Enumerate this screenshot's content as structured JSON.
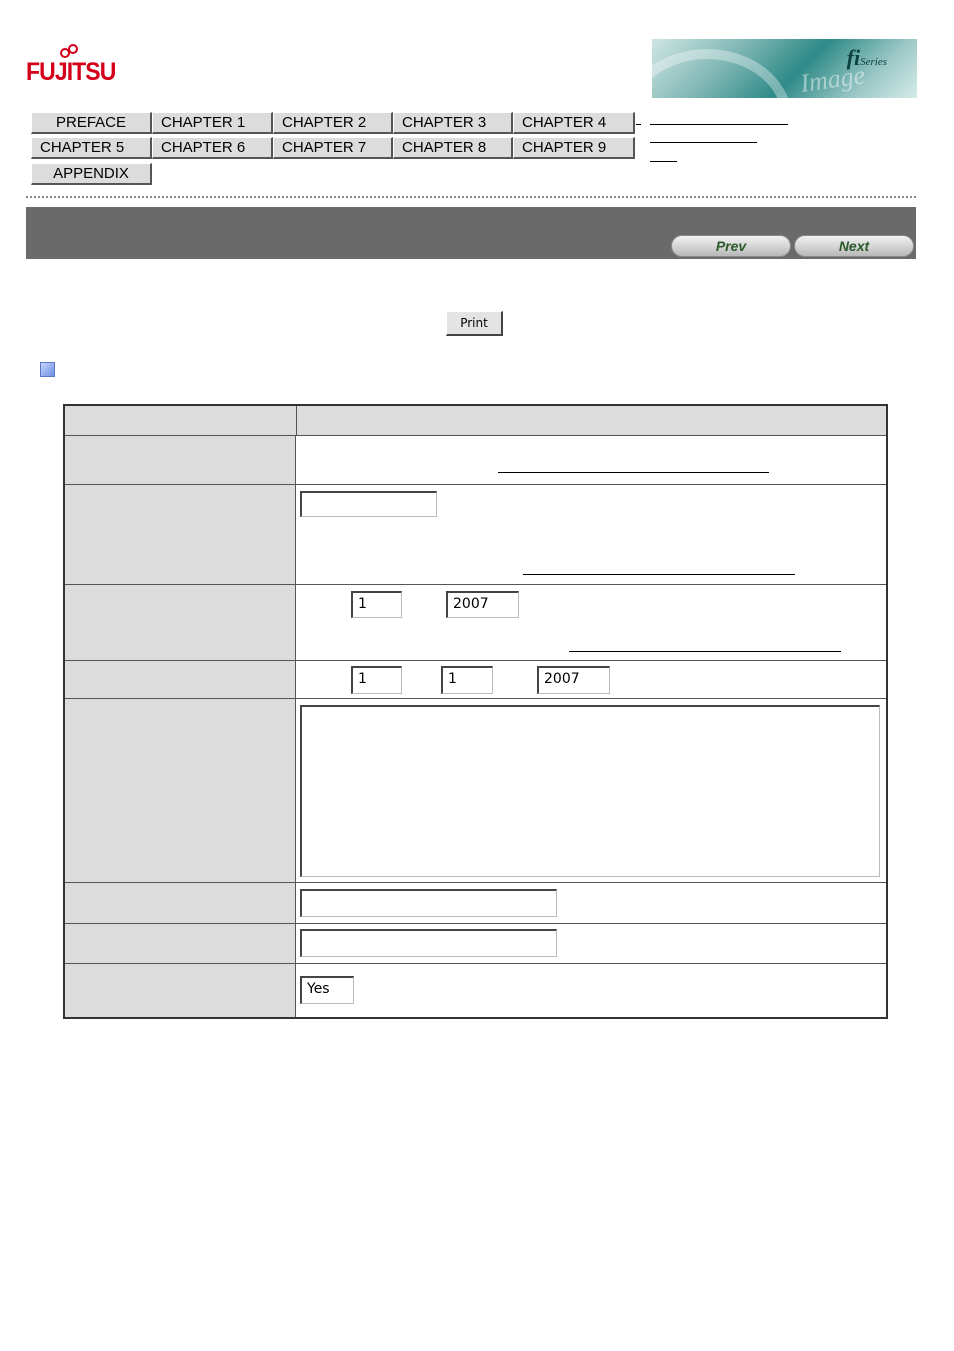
{
  "brand": {
    "logo_text": "FUJITSU",
    "banner_fi": "fi",
    "banner_series": "Series",
    "banner_watermark": "Image Scanner"
  },
  "nav": {
    "row1": [
      "PREFACE",
      "CHAPTER 1",
      "CHAPTER 2",
      "CHAPTER 3",
      "CHAPTER 4"
    ],
    "row2": [
      "CHAPTER 5",
      "CHAPTER 6",
      "CHAPTER 7",
      "CHAPTER 8",
      "CHAPTER 9"
    ],
    "row3": [
      "APPENDIX"
    ]
  },
  "pager": {
    "prev": "Prev",
    "next": "Next"
  },
  "print_label": "Print",
  "form": {
    "field_a": "",
    "month_1": "1",
    "year_1": "2007",
    "month_2": "1",
    "day_2": "1",
    "year_2": "2007",
    "textarea": "",
    "text_1": "",
    "text_2": "",
    "select_value": "Yes"
  },
  "colors": {
    "brand_red": "#d4001a",
    "header_bar": "#6a6a6a",
    "table_label_bg": "#dcdcdc"
  }
}
